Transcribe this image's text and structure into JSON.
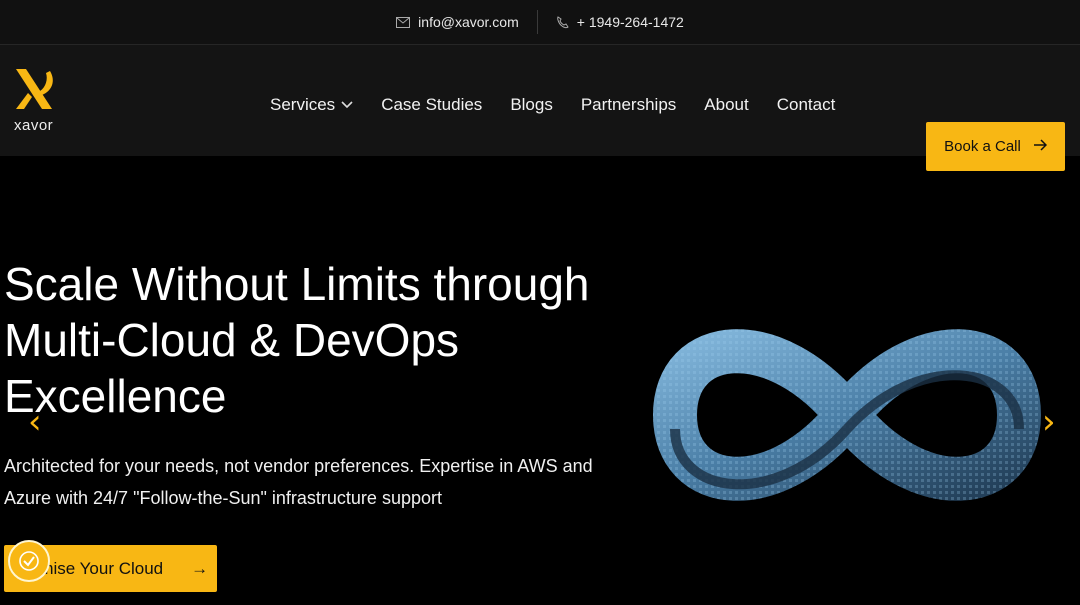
{
  "topbar": {
    "email": "info@xavor.com",
    "email_icon": "mail-icon",
    "phone": "+ 1949-264-1472",
    "phone_icon": "phone-icon"
  },
  "nav": {
    "logo_text": "xavor",
    "items": [
      {
        "label": "Services",
        "has_dropdown": true
      },
      {
        "label": "Case Studies"
      },
      {
        "label": "Blogs"
      },
      {
        "label": "Partnerships"
      },
      {
        "label": "About"
      },
      {
        "label": "Contact"
      }
    ],
    "cta_label": "Book a Call"
  },
  "hero": {
    "title_lines": [
      "Scale Without Limits through",
      "Multi-Cloud & DevOps",
      "Excellence"
    ],
    "subtitle": "Architected for your needs, not vendor preferences. Expertise in AWS and Azure with 24/7 \"Follow-the-Sun\" infrastructure support",
    "button_label": "timise Your Cloud",
    "button_arrow": "→"
  },
  "carousel": {
    "prev_glyph": "‹",
    "next_glyph": "›"
  },
  "colors": {
    "accent": "#f8b714",
    "background": "#000000",
    "nav_bg": "#141414",
    "infinity": "#5a8fb5"
  }
}
